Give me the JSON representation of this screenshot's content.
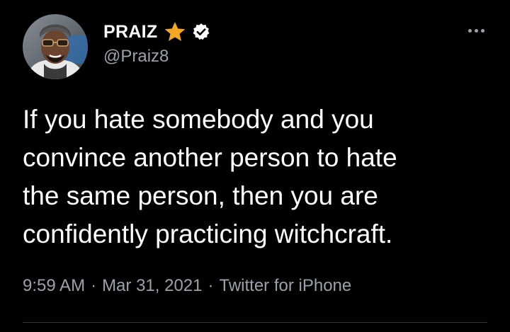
{
  "user": {
    "display_name": "PRAIZ",
    "handle": "@Praiz8",
    "star_badge_color": "#f5a623",
    "verified_badge_color": "#ffffff"
  },
  "tweet": {
    "lines": [
      "If you hate somebody and you",
      "convince another person to hate",
      "the same person, then you are",
      "confidently practicing witchcraft."
    ],
    "time": "9:59 AM",
    "separator": "·",
    "date": "Mar 31, 2021",
    "source": "Twitter for iPhone"
  },
  "icons": {
    "avatar": "profile-photo",
    "star": "star-icon",
    "verified": "verified-badge-icon",
    "more": "more-options-icon"
  },
  "colors": {
    "background": "#000000",
    "text": "#ffffff",
    "secondary_text": "#9aa2a9",
    "divider": "#2f3336"
  }
}
